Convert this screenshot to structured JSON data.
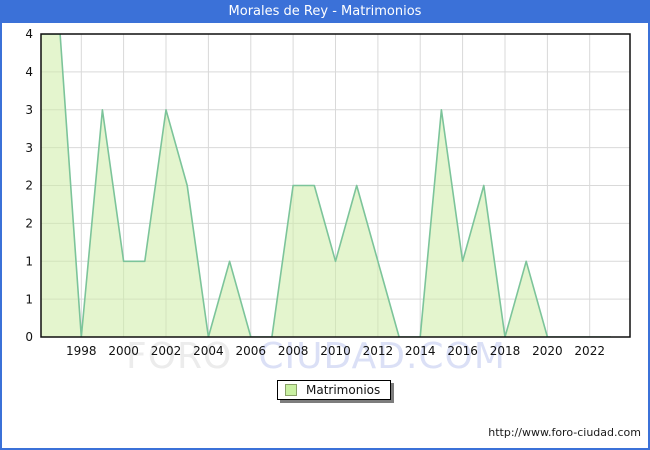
{
  "window": {
    "title": "Morales de Rey - Matrimonios"
  },
  "chart_data": {
    "type": "area",
    "title": "Morales de Rey - Matrimonios",
    "xlabel": "",
    "ylabel": "",
    "grid": true,
    "legend_position": "bottom-center",
    "ylim": [
      0,
      4
    ],
    "xlim": [
      1996.1,
      2023.9
    ],
    "x": [
      1996,
      1997,
      1998,
      1999,
      2000,
      2001,
      2002,
      2003,
      2004,
      2005,
      2006,
      2007,
      2008,
      2009,
      2010,
      2011,
      2012,
      2013,
      2014,
      2015,
      2016,
      2017,
      2018,
      2019,
      2020,
      2021,
      2022,
      2023
    ],
    "series": [
      {
        "name": "Matrimonios",
        "values": [
          4,
          4,
          0,
          3,
          1,
          1,
          3,
          2,
          0,
          1,
          0,
          0,
          2,
          2,
          1,
          2,
          1,
          0,
          0,
          3,
          1,
          2,
          0,
          1,
          0,
          0,
          0,
          0
        ]
      }
    ],
    "x_tick_years": [
      1998,
      2000,
      2002,
      2004,
      2006,
      2008,
      2010,
      2012,
      2014,
      2016,
      2018,
      2020,
      2022
    ],
    "y_ticks": [
      {
        "value": 4.0,
        "label": "4"
      },
      {
        "value": 3.5,
        "label": "4"
      },
      {
        "value": 3.0,
        "label": "3"
      },
      {
        "value": 2.5,
        "label": "3"
      },
      {
        "value": 2.0,
        "label": "2"
      },
      {
        "value": 1.5,
        "label": "2"
      },
      {
        "value": 1.0,
        "label": "1"
      },
      {
        "value": 0.5,
        "label": "1"
      },
      {
        "value": 0.0,
        "label": "0"
      }
    ],
    "colors": {
      "area_fill": "#cdeca6",
      "area_fill_opacity": "0.55",
      "line": "#7cc49a",
      "grid": "#d9d9d9",
      "plot_border": "#0f0f0f",
      "tick_text": "#111111",
      "titlebar_bg": "#3b71d8",
      "titlebar_text": "#ffffff",
      "frame_border": "#3b71d8"
    }
  },
  "legend": {
    "label": "Matrimonios"
  },
  "watermark": {
    "part1": "FORO",
    "part2": "CIUDAD.COM"
  },
  "footer": {
    "url": "http://www.foro-ciudad.com"
  }
}
